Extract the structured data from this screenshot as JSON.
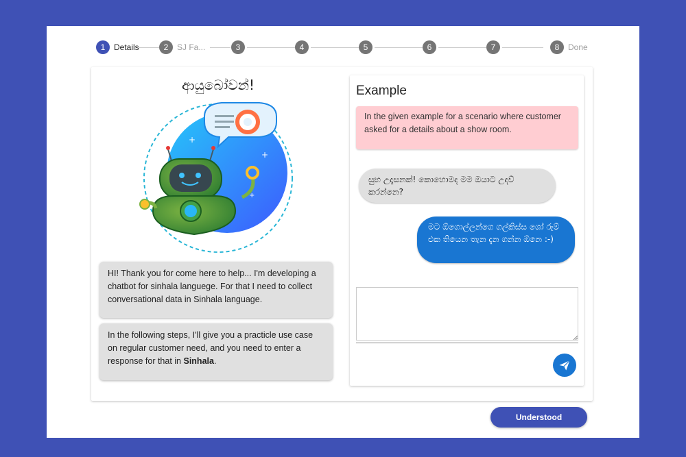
{
  "stepper": {
    "steps": [
      {
        "number": "1",
        "label": "Details"
      },
      {
        "number": "2",
        "label": "SJ Fa..."
      },
      {
        "number": "3",
        "label": ""
      },
      {
        "number": "4",
        "label": ""
      },
      {
        "number": "5",
        "label": ""
      },
      {
        "number": "6",
        "label": ""
      },
      {
        "number": "7",
        "label": ""
      },
      {
        "number": "8",
        "label": "Done"
      }
    ],
    "active_step": 1
  },
  "intro": {
    "greeting": "ආයුබෝවන්!",
    "bubble1": "HI! Thank you for come here to help... I'm developing a chatbot for sinhala languege. For that I need to collect conversational data in Sinhala language.",
    "bubble2_text": "In the following steps, I'll give you a practicle use case on regular customer need, and you need to enter a response for that in ",
    "bubble2_bold": "Sinhala",
    "bubble2_end": "."
  },
  "example": {
    "title": "Example",
    "description": "In the given example for a scenario where customer asked for a details about a show room.",
    "incoming_message": "සුභ උදෑසනක්! කොහොමද මම ඔයාට උදව් කරන්නෙ?",
    "outgoing_message": "මට ඕගොල්ලන්ගෙ ගල්කිස්ස ශෝ රූම් එක තියෙන තැන දැන ගන්න ඕනෙ :-)",
    "reply_value": "",
    "send_icon": "send-icon"
  },
  "actions": {
    "understood_label": "Understood"
  },
  "colors": {
    "primary": "#3f51b5",
    "message_out": "#1976d2",
    "alert_bg": "#ffcdd2",
    "bubble_bg": "#e0e0e0"
  }
}
